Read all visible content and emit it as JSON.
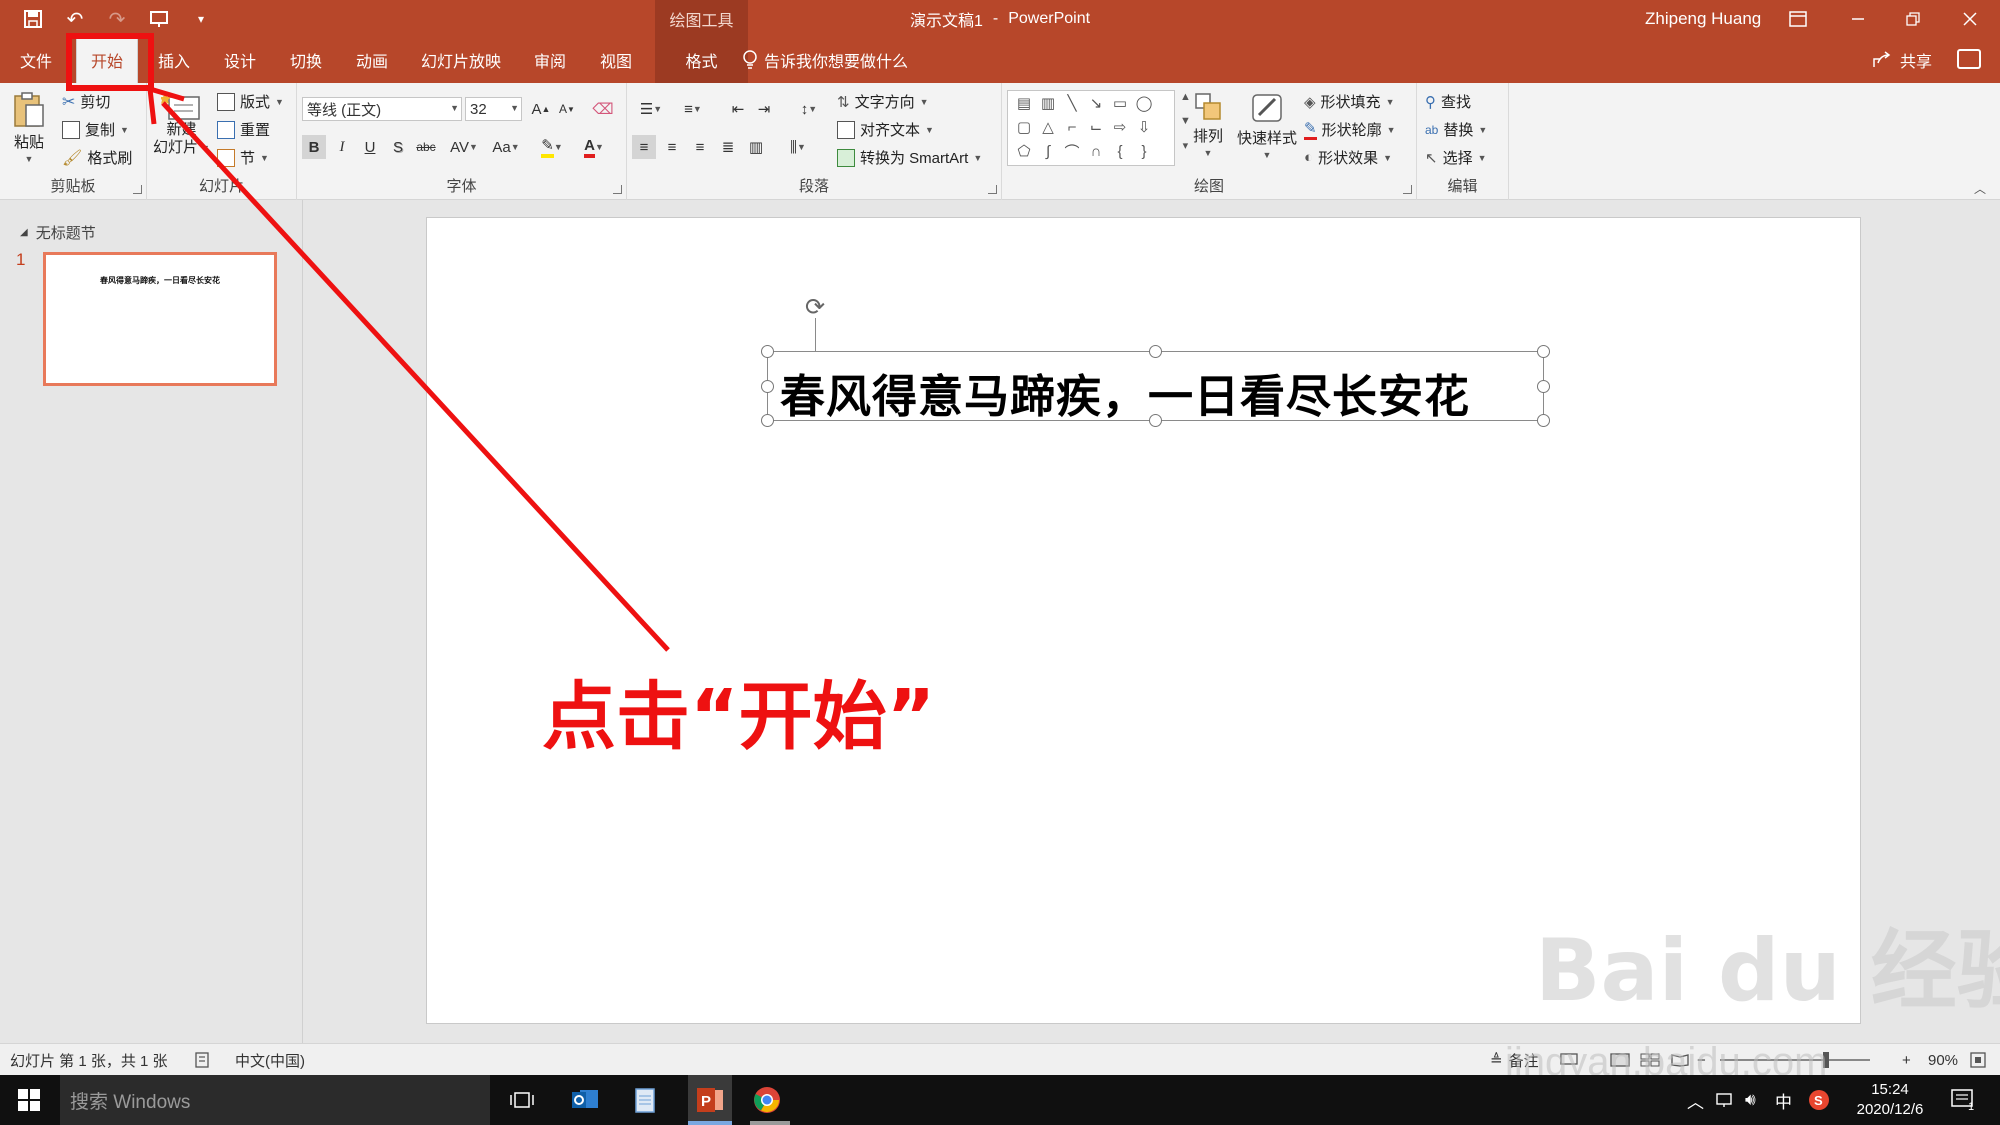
{
  "titlebar": {
    "context_tool": "绘图工具",
    "doc_name": "演示文稿1",
    "app_name": "PowerPoint",
    "user": "Zhipeng Huang"
  },
  "tabs": [
    "文件",
    "开始",
    "插入",
    "设计",
    "切换",
    "动画",
    "幻灯片放映",
    "审阅",
    "视图",
    "格式"
  ],
  "tell_me": "告诉我你想要做什么",
  "share": "共享",
  "ribbon": {
    "clipboard": {
      "paste": "粘贴",
      "cut": "剪切",
      "copy": "复制",
      "format_painter": "格式刷",
      "label": "剪贴板"
    },
    "slides": {
      "new_slide_1": "新建",
      "new_slide_2": "幻灯片",
      "layout": "版式",
      "reset": "重置",
      "section": "节",
      "label": "幻灯片"
    },
    "font": {
      "font_name": "等线 (正文)",
      "font_size": "32",
      "label": "字体"
    },
    "paragraph": {
      "text_direction": "文字方向",
      "align_text": "对齐文本",
      "convert_smartart": "转换为 SmartArt",
      "label": "段落"
    },
    "drawing": {
      "arrange": "排列",
      "quick_styles": "快速样式",
      "shape_fill": "形状填充",
      "shape_outline": "形状轮廓",
      "shape_effects": "形状效果",
      "label": "绘图"
    },
    "editing": {
      "find": "查找",
      "replace": "替换",
      "select": "选择",
      "label": "编辑"
    }
  },
  "slides_pane": {
    "section_name": "无标题节",
    "slide_number": "1",
    "thumbnail_text": "春风得意马蹄疾，一日看尽长安花"
  },
  "slide": {
    "textbox_text": "春风得意马蹄疾，一日看尽长安花"
  },
  "annotation": {
    "callout": "点击“开始”"
  },
  "statusbar": {
    "slide_info": "幻灯片 第 1 张，共 1 张",
    "language": "中文(中国)",
    "notes": "备注",
    "zoom": "90%"
  },
  "taskbar": {
    "search_placeholder": "搜索 Windows",
    "ime": "中",
    "time": "15:24",
    "date": "2020/12/6",
    "notification_count": "1"
  },
  "watermark": {
    "logo": "Bai du 经验",
    "url": "jingyan.baidu.com"
  },
  "colors": {
    "accent": "#b7472a",
    "callout_red": "#ee1111",
    "thumb_border": "#e8795a"
  }
}
